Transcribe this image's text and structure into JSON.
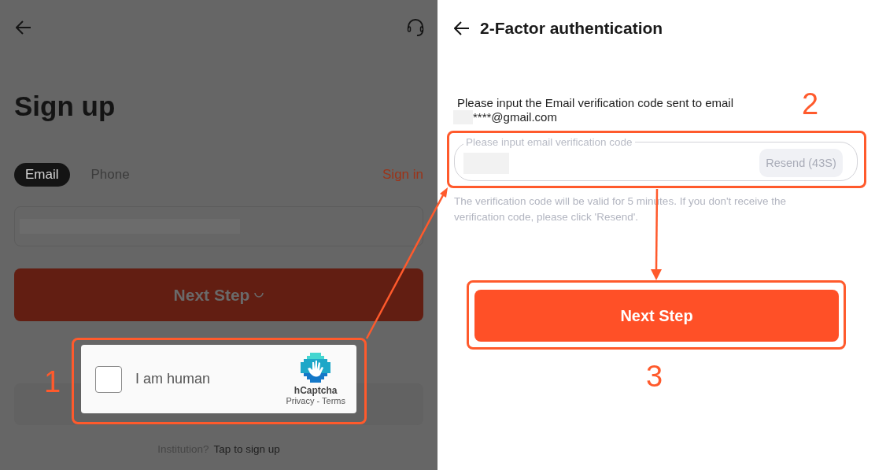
{
  "signup_screen": {
    "title": "Sign up",
    "tabs": [
      {
        "label": "Email",
        "selected": true
      },
      {
        "label": "Phone",
        "selected": false
      }
    ],
    "sign_in_link": "Sign in",
    "next_button": "Next Step",
    "captcha": {
      "label": "I am human",
      "checked": false,
      "brand": "hCaptcha",
      "links": "Privacy - Terms"
    },
    "footer": {
      "question": "Institution?",
      "link": "Tap to sign up"
    }
  },
  "verify_screen": {
    "title": "2-Factor authentication",
    "prompt": "Please input the Email verification code sent to email",
    "email": "****@gmail.com",
    "code_field": {
      "placeholder": "Please input email verification code"
    },
    "resend_button": "Resend (43S)",
    "hint": "The verification code will be valid for 5 minutes. If you don't receive the verification code, please click 'Resend'.",
    "next_button": "Next Step"
  },
  "annotations": [
    {
      "number": "1"
    },
    {
      "number": "2"
    },
    {
      "number": "3"
    }
  ]
}
